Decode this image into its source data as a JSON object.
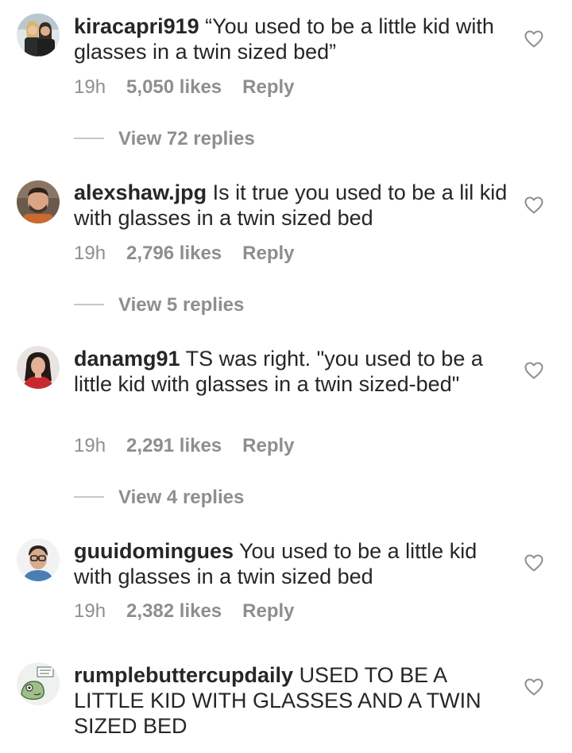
{
  "comments": [
    {
      "username": "kiracapri919",
      "text": "“You used to be a little kid with glasses in a twin sized bed”",
      "time": "19h",
      "likes": "5,050 likes",
      "reply": "Reply",
      "view_replies": "View 72 replies",
      "avatar_icon": "profile-photo"
    },
    {
      "username": "alexshaw.jpg",
      "text": "Is it true you used to be a lil kid with glasses in a twin sized bed",
      "time": "19h",
      "likes": "2,796 likes",
      "reply": "Reply",
      "view_replies": "View 5 replies",
      "avatar_icon": "profile-photo"
    },
    {
      "username": "danamg91",
      "text": "TS was right. \"you used to be a little kid with glasses in a twin sized-bed\"",
      "time": "19h",
      "likes": "2,291 likes",
      "reply": "Reply",
      "view_replies": "View 4 replies",
      "avatar_icon": "profile-photo"
    },
    {
      "username": "guuidomingues",
      "text": "You used to be a little kid with glasses in a twin sized bed",
      "time": "19h",
      "likes": "2,382 likes",
      "reply": "Reply",
      "avatar_icon": "profile-photo"
    },
    {
      "username": "rumplebuttercupdaily",
      "text": "USED TO BE A LITTLE KID WITH GLASSES AND A TWIN SIZED BED",
      "avatar_icon": "profile-photo"
    }
  ],
  "colors": {
    "text": "#262626",
    "secondary": "#8e8e8e",
    "divider": "#c7c7c7",
    "background": "#ffffff"
  },
  "icons": {
    "like": "heart-outline-icon"
  }
}
